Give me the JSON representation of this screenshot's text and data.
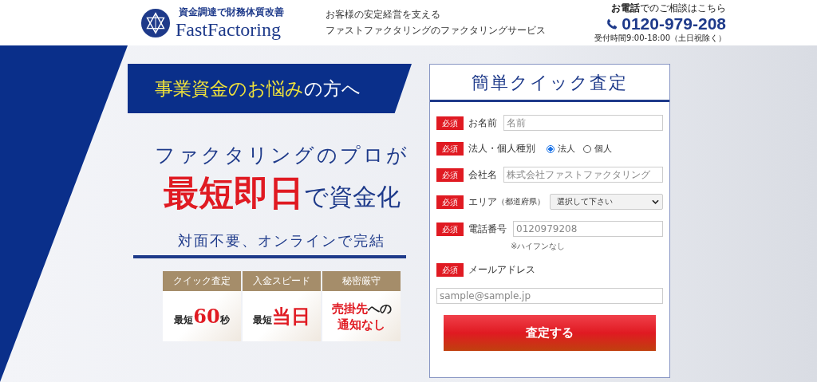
{
  "header": {
    "logo": {
      "tagline": "資金調達で財務体質改善",
      "name": "FastFactoring"
    },
    "catchphrase": [
      "お客様の安定経営を支える",
      "ファストファクタリングのファクタリングサービス"
    ],
    "contact": {
      "lead": "**お電話**でのご相談はこちら",
      "phone": "0120-979-208",
      "hours": "受付時間9:00-18:00（土日祝除く）"
    }
  },
  "hero": {
    "banner": [
      {
        "text": "事業資金のお悩み",
        "accent": true
      },
      {
        "text": "の方へ",
        "accent": false
      }
    ],
    "headline": "ファクタリングのプロが",
    "headline2": [
      {
        "text": "最短即日",
        "accent": true
      },
      {
        "text": "で資金化",
        "accent": false
      }
    ],
    "subline": "対面不要、オンラインで完結",
    "features": [
      {
        "title": "クイック査定",
        "lines": [
          [
            {
              "text": "最短",
              "accent": false
            },
            {
              "text": "60",
              "accent": true
            },
            {
              "text": "秒",
              "accent": false
            }
          ]
        ]
      },
      {
        "title": "入金スピード",
        "lines": [
          [
            {
              "text": "最短",
              "accent": false
            },
            {
              "text": "当日",
              "accent": true
            }
          ]
        ]
      },
      {
        "title": "秘密厳守",
        "lines": [
          [
            {
              "text": "売掛先",
              "accent": true
            },
            {
              "text": "への",
              "accent": false
            }
          ],
          [
            {
              "text": "通知なし",
              "accent": true
            }
          ]
        ]
      }
    ]
  },
  "form": {
    "title": "簡単クイック査定",
    "fields": [
      {
        "kind": "text",
        "required": "必須",
        "label": "お名前",
        "placeholder": "名前"
      },
      {
        "kind": "radio",
        "required": "必須",
        "label": "法人・個人種別",
        "options": [
          {
            "label": "法人",
            "selected": true
          },
          {
            "label": "個人",
            "selected": false
          }
        ]
      },
      {
        "kind": "text",
        "required": "必須",
        "label": "会社名",
        "placeholder": "株式会社ファストファクタリング"
      },
      {
        "kind": "select",
        "required": "必須",
        "label": "エリア",
        "note": "（都道府県）",
        "value": "選択して下さい"
      },
      {
        "kind": "text",
        "required": "必須",
        "label": "電話番号",
        "placeholder": "0120979208",
        "hint": "※ハイフンなし"
      },
      {
        "kind": "stacked",
        "required": "必須",
        "label": "メールアドレス",
        "placeholder": "sample@sample.jp"
      }
    ],
    "submit": "査定する"
  }
}
